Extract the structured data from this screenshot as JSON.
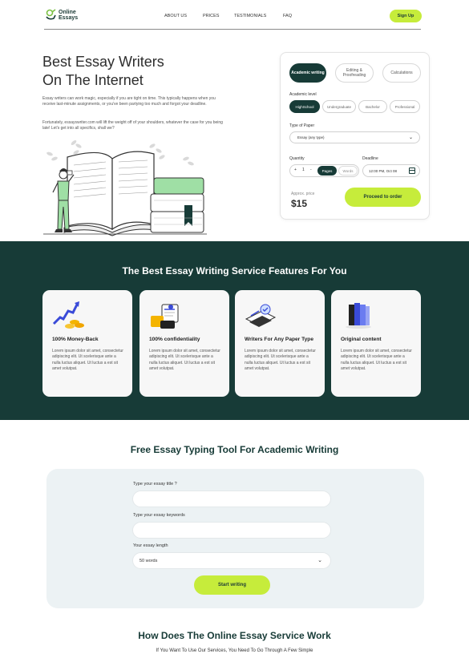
{
  "colors": {
    "accent": "#c6ec3b",
    "brand": "#173b37",
    "panel": "#ecf2f4"
  },
  "header": {
    "logo_line1": "Online",
    "logo_line2": "Essays",
    "nav": [
      "ABOUT US",
      "PRICES",
      "TESTIMONIALS",
      "FAQ"
    ],
    "signup_label": "Sign Up"
  },
  "hero": {
    "title_line1": "Best Essay Writers",
    "title_line2": "On The Internet",
    "para1": "Essay writers can work magic, especially if you are tight on time. This typically happens when you receive last-minute assignments, or you've been partying too much and forgot your deadline.",
    "para2": "Fortunately, essayswriter.com will lift the weight off of your shoulders, whatever the case for you being late! Let's get into all specifics, shall we?"
  },
  "order": {
    "service_tabs": [
      "Academic writing",
      "Editing & Proofreading",
      "Calculations"
    ],
    "level_label": "Academic level",
    "levels": [
      "HighSchool",
      "Undergraduate",
      "Bachelor",
      "Professional"
    ],
    "paper_label": "Type of Paper",
    "paper_value": "Essay (any type)",
    "quantity_label": "Quantity",
    "minus": "+",
    "quantity": "1",
    "plus": "-",
    "unit_pages": "Pages",
    "unit_words": "Words",
    "deadline_label": "Deadline",
    "deadline_value": "12:00 PM, Oct 08",
    "approx_label": "Approx. price",
    "price": "$15",
    "proceed_label": "Proceed to order"
  },
  "features": {
    "title": "The Best Essay Writing Service Features For You",
    "items": [
      {
        "icon": "money-back-icon",
        "title": "100% Money-Back",
        "desc": "Lorem ipsum dolor sit amet, consectetur adipiscing elit. Ut scelerisque ante a nulla luctus aliquet. Ut luctus a est sit amet volutpat."
      },
      {
        "icon": "confidentiality-icon",
        "title": "100% confidentiality",
        "desc": "Lorem ipsum dolor sit amet, consectetur adipiscing elit. Ut scelerisque ante a nulla luctus aliquet. Ut luctus a est sit amet volutpat."
      },
      {
        "icon": "writers-icon",
        "title": "Writers For Any Paper Type",
        "desc": "Lorem ipsum dolor sit amet, consectetur adipiscing elit. Ut scelerisque ante a nulla luctus aliquet. Ut luctus a est sit amet volutpat."
      },
      {
        "icon": "original-content-icon",
        "title": "Original content",
        "desc": "Lorem ipsum dolor sit amet, consectetur adipiscing elit. Ut scelerisque ante a nulla luctus aliquet. Ut luctus a est sit amet volutpat."
      }
    ]
  },
  "tool": {
    "title": "Free Essay Typing Tool For Academic Writing",
    "essay_title_label": "Type your essay title ?",
    "essay_title_value": "",
    "keywords_label": "Type your essay keywords",
    "keywords_value": "",
    "length_label": "Your essay length",
    "length_value": "50 words",
    "start_label": "Start writing"
  },
  "how": {
    "title": "How Does The Online Essay Service Work",
    "subtitle": "If You Want To Use Our Services, You Need To Go Through A Few Simple"
  }
}
